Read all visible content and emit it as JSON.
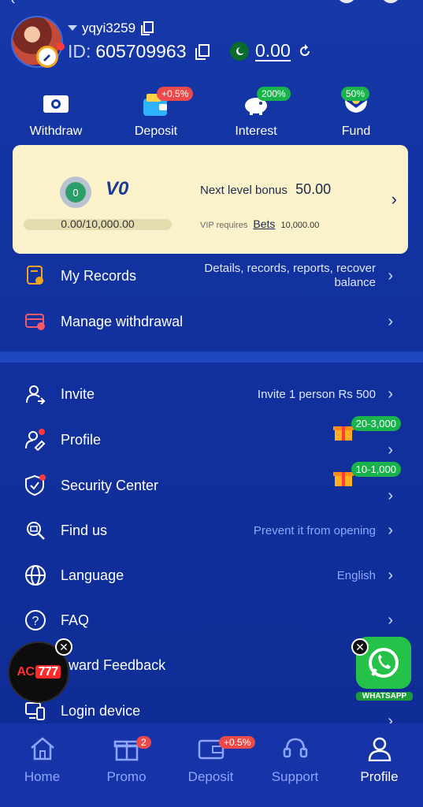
{
  "header": {
    "username": "yqyi3259",
    "id_label": "ID:",
    "id_value": "605709963",
    "balance": "0.00"
  },
  "quick_actions": [
    {
      "label": "Withdraw",
      "tag": ""
    },
    {
      "label": "Deposit",
      "tag": "+0.5%"
    },
    {
      "label": "Interest",
      "tag": "200%"
    },
    {
      "label": "Fund",
      "tag": "50%"
    }
  ],
  "vip": {
    "medal_number": "0",
    "level": "V0",
    "progress_text": "0.00/10,000.00",
    "progress_fraction": 0,
    "next_level_label": "Next level bonus",
    "next_level_value": "50.00",
    "requires_label": "VIP requires",
    "requires_link": "Bets",
    "requires_value": "10,000.00"
  },
  "menu_top": [
    {
      "label": "My Records",
      "right": "Details, records, reports, recover",
      "right2": "balance"
    },
    {
      "label": "Manage withdrawal",
      "right": "",
      "right2": ""
    }
  ],
  "menu_bottom": [
    {
      "label": "Invite",
      "right": "Invite 1 person Rs 500"
    },
    {
      "label": "Profile",
      "gift_tag": "20-3,000"
    },
    {
      "label": "Security Center",
      "gift_tag": "10-1,000"
    },
    {
      "label": "Find us",
      "right": "Prevent it from opening"
    },
    {
      "label": "Language",
      "right": "English"
    },
    {
      "label": "FAQ",
      "right": ""
    },
    {
      "label": "eward Feedback",
      "right": ""
    },
    {
      "label": "Login device",
      "right": ""
    }
  ],
  "floating": {
    "ac_logo": "AC",
    "ac_logo_num": "777",
    "close_glyph": "✕",
    "whatsapp_label": "WHATSAPP"
  },
  "bottom_nav": [
    {
      "label": "Home",
      "badge": ""
    },
    {
      "label": "Promo",
      "badge": "2"
    },
    {
      "label": "Deposit",
      "badge": "+0.5%"
    },
    {
      "label": "Support",
      "badge": ""
    },
    {
      "label": "Profile",
      "badge": ""
    }
  ],
  "colors": {
    "background": "#1232a0",
    "vip_card": "#fbf2cc",
    "red_badge": "#ec4a4a",
    "green_badge": "#19b34b"
  }
}
